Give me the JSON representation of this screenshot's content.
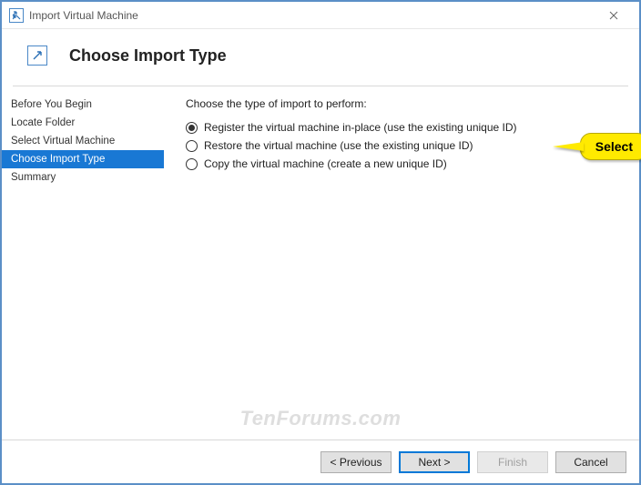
{
  "window": {
    "title": "Import Virtual Machine",
    "heading": "Choose Import Type"
  },
  "sidebar": {
    "items": [
      {
        "label": "Before You Begin",
        "active": false
      },
      {
        "label": "Locate Folder",
        "active": false
      },
      {
        "label": "Select Virtual Machine",
        "active": false
      },
      {
        "label": "Choose Import Type",
        "active": true
      },
      {
        "label": "Summary",
        "active": false
      }
    ]
  },
  "main": {
    "prompt": "Choose the type of import to perform:",
    "options": [
      {
        "label": "Register the virtual machine in-place (use the existing unique ID)",
        "checked": true
      },
      {
        "label": "Restore the virtual machine (use the existing unique ID)",
        "checked": false
      },
      {
        "label": "Copy the virtual machine (create a new unique ID)",
        "checked": false
      }
    ]
  },
  "callout": {
    "text": "Select"
  },
  "buttons": {
    "previous": "< Previous",
    "next": "Next >",
    "finish": "Finish",
    "cancel": "Cancel"
  },
  "watermark": "TenForums.com"
}
